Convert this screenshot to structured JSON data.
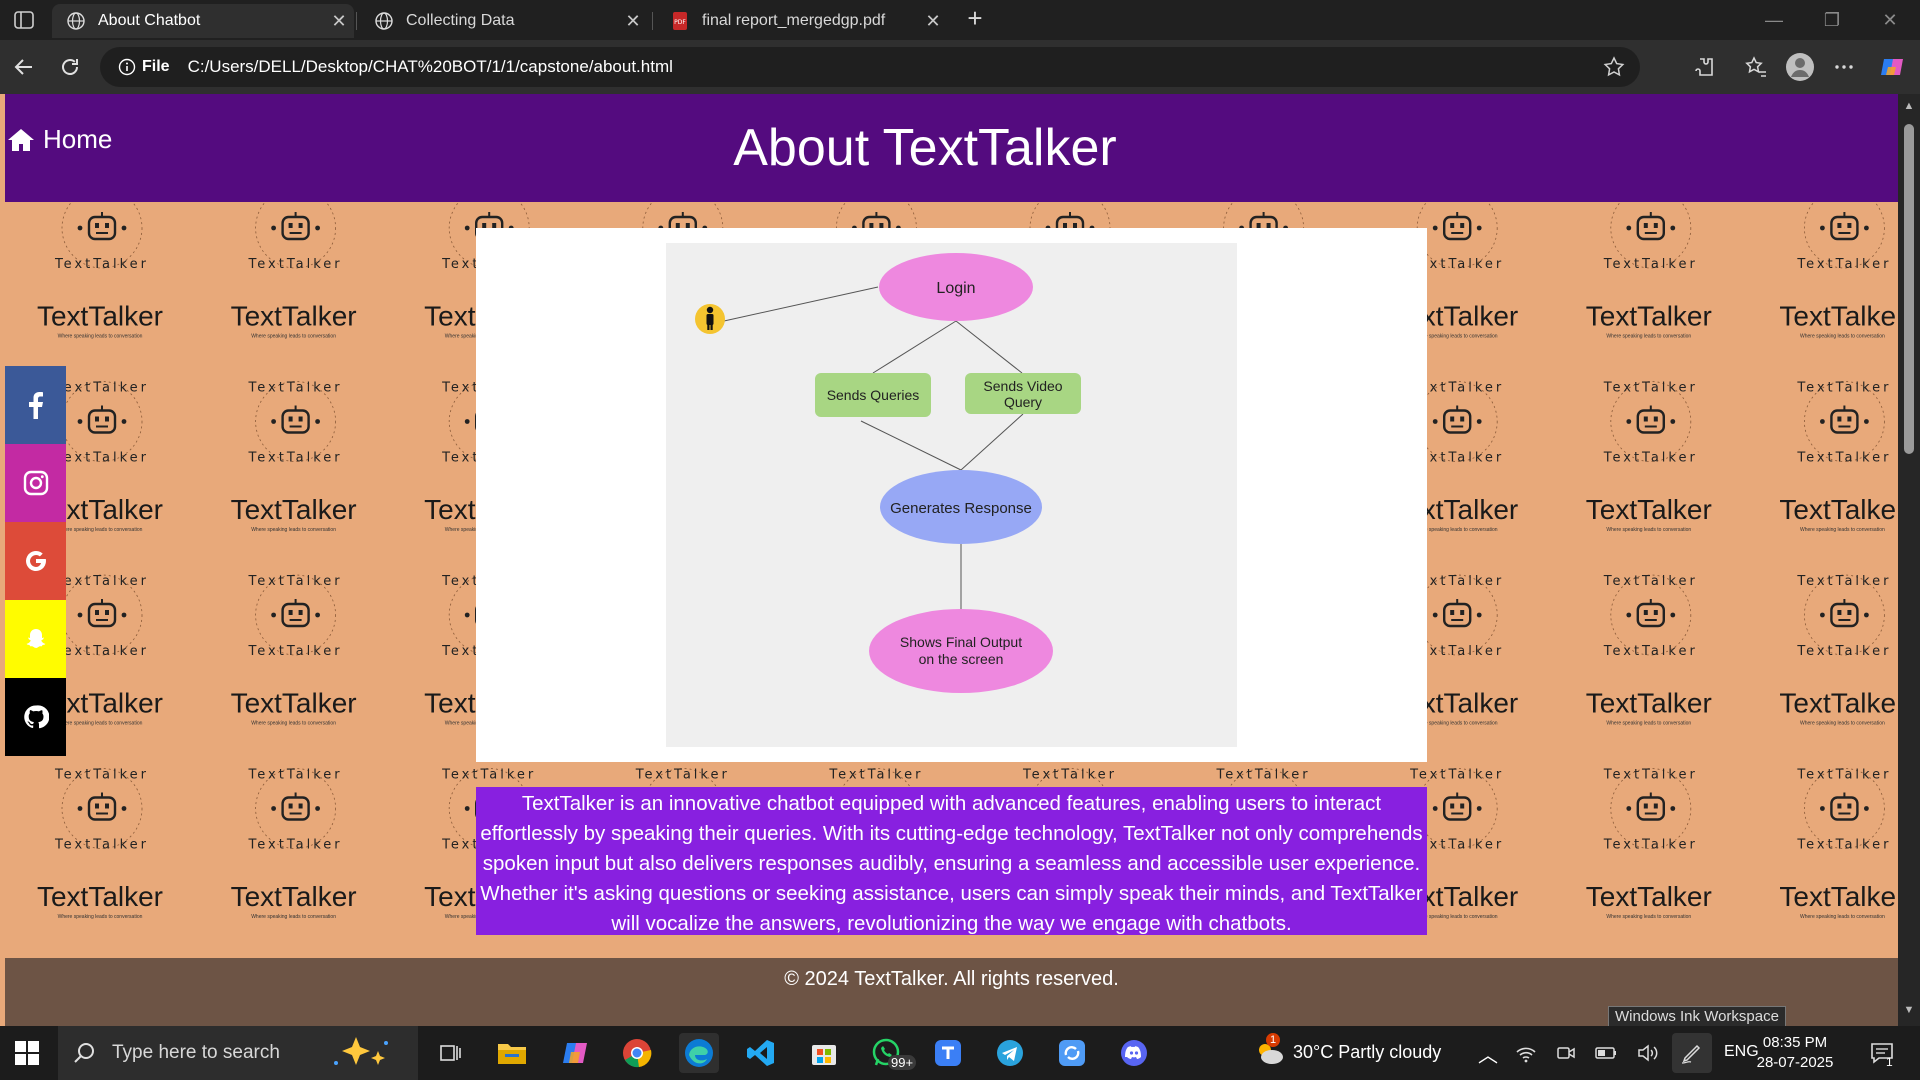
{
  "browser": {
    "tabs": [
      {
        "title": "About Chatbot",
        "active": true
      },
      {
        "title": "Collecting Data",
        "active": false
      },
      {
        "title": "final report_mergedgp.pdf",
        "active": false
      }
    ],
    "address": {
      "site_label": "File",
      "url": "C:/Users/DELL/Desktop/CHAT%20BOT/1/1/capstone/about.html"
    }
  },
  "page": {
    "home_label": "Home",
    "title": "About TextTalker",
    "wallpaper": {
      "brand": "TextTalker",
      "tagline": "Where speaking leads to conversation",
      "circle_text": "TextTalker"
    },
    "social": [
      {
        "name": "facebook",
        "color": "#3b5998"
      },
      {
        "name": "instagram",
        "color": "#c32aa3"
      },
      {
        "name": "google",
        "color": "#dd4b39"
      },
      {
        "name": "snapchat",
        "color": "#fffc00"
      },
      {
        "name": "github",
        "color": "#000000"
      }
    ],
    "diagram": {
      "nodes": {
        "login": "Login",
        "sends_queries": "Sends Queries",
        "sends_video_1": "Sends Video",
        "sends_video_2": "Query",
        "generates": "Generates Response",
        "output_1": "Shows Final Output",
        "output_2": "on the screen"
      }
    },
    "description": "TextTalker is an innovative chatbot equipped with advanced features, enabling users to interact effortlessly by speaking their queries. With its cutting-edge technology, TextTalker not only comprehends spoken input but also delivers responses audibly, ensuring a seamless and accessible user experience. Whether it's asking questions or seeking assistance, users can simply speak their minds, and TextTalker will vocalize the answers, revolutionizing the way we engage with chatbots.",
    "footer": "© 2024 TextTalker. All rights reserved."
  },
  "tooltip": "Windows Ink Workspace",
  "taskbar": {
    "search_placeholder": "Type here to search",
    "whatsapp_badge": "99+",
    "weather": "30°C  Partly cloudy",
    "weather_badge": "1",
    "language": "ENG",
    "time": "08:35 PM",
    "date": "28-07-2025",
    "notification_count": "1"
  }
}
